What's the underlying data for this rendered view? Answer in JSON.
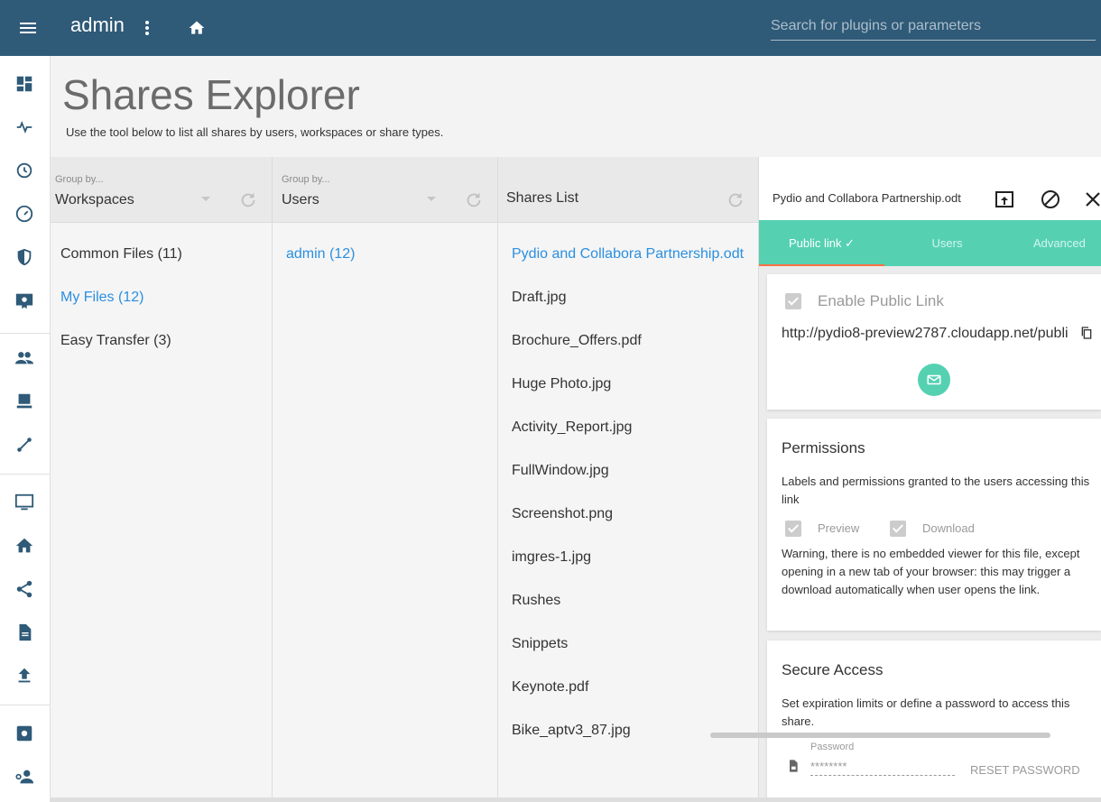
{
  "appbar": {
    "title": "admin",
    "search_placeholder": "Search for plugins or parameters",
    "bg": "#2f5a78"
  },
  "sidenav": {
    "items": [
      {
        "icon": "dashboard-icon"
      },
      {
        "icon": "activity-pulse-icon"
      },
      {
        "icon": "history-icon"
      },
      {
        "icon": "speedometer-icon"
      },
      {
        "icon": "shield-icon"
      },
      {
        "icon": "certificate-icon"
      },
      {
        "icon": "people-icon"
      },
      {
        "icon": "workspace-monitor-icon"
      },
      {
        "icon": "connection-icon"
      },
      {
        "icon": "desktop-icon"
      },
      {
        "icon": "home-icon"
      },
      {
        "icon": "share-icon"
      },
      {
        "icon": "document-icon"
      },
      {
        "icon": "upload-icon"
      },
      {
        "icon": "settings-plugin-icon"
      },
      {
        "icon": "user-key-icon"
      }
    ]
  },
  "page": {
    "title": "Shares Explorer",
    "description": "Use the tool below to list all shares by users, workspaces or share types."
  },
  "col_workspaces": {
    "group_label": "Group by...",
    "group_value": "Workspaces",
    "items": [
      "Common Files (11)",
      "My Files (12)",
      "Easy Transfer (3)"
    ],
    "active_index": 1
  },
  "col_users": {
    "group_label": "Group by...",
    "group_value": "Users",
    "items": [
      "admin (12)"
    ],
    "active_index": 0
  },
  "col_shares": {
    "title": "Shares List",
    "items": [
      "Pydio and Collabora Partnership.odt",
      "Draft.jpg",
      "Brochure_Offers.pdf",
      "Huge Photo.jpg",
      "Activity_Report.jpg",
      "FullWindow.jpg",
      "Screenshot.png",
      "imgres-1.jpg",
      "Rushes",
      "Snippets",
      "Keynote.pdf",
      "Bike_aptv3_87.jpg"
    ],
    "active_index": 0
  },
  "detail": {
    "title": "Pydio and Collabora Partnership.odt",
    "tabs": [
      "Public link ✓",
      "Users",
      "Advanced"
    ],
    "accent": "#55d1b2",
    "public_link": {
      "enable_label": "Enable Public Link",
      "url": "http://pydio8-preview2787.cloudapp.net/publi"
    },
    "permissions": {
      "title": "Permissions",
      "desc": "Labels and permissions granted to the users accessing this link",
      "preview_label": "Preview",
      "download_label": "Download",
      "warning": "Warning, there is no embedded viewer for this file, except opening in a new tab of your browser: this may trigger a download automatically when user opens the link."
    },
    "secure": {
      "title": "Secure Access",
      "desc": "Set expiration limits or define a password to access this share.",
      "password_label": "Password",
      "password_value": "********",
      "reset_label": "RESET PASSWORD"
    }
  }
}
